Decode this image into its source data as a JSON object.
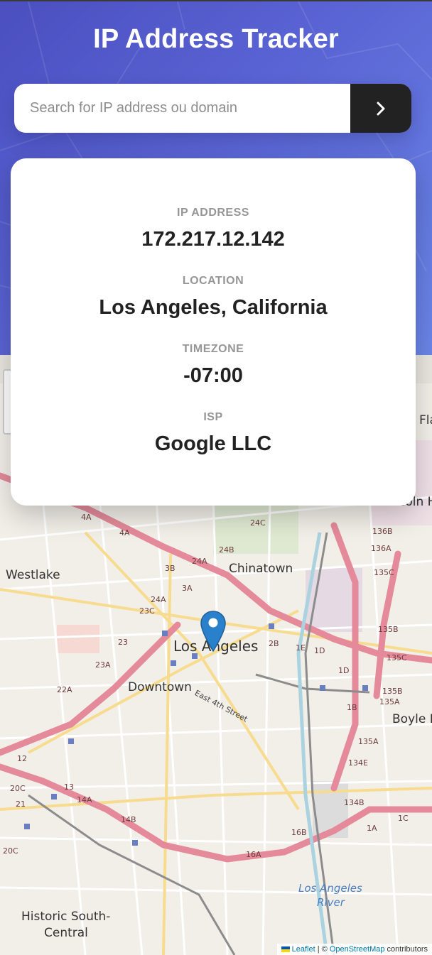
{
  "header": {
    "title": "IP Address Tracker",
    "search_placeholder": "Search for IP address ou domain",
    "search_value": ""
  },
  "info": {
    "ip_label": "IP ADDRESS",
    "ip_value": "172.217.12.142",
    "location_label": "LOCATION",
    "location_value": "Los Angeles, California",
    "timezone_label": "TIMEZONE",
    "timezone_value": "-07:00",
    "isp_label": "ISP",
    "isp_value": "Google LLC"
  },
  "map": {
    "places": {
      "los_angeles": "Los Angeles",
      "downtown": "Downtown",
      "chinatown": "Chinatown",
      "westlake": "Westlake",
      "boyle_heights": "Boyle He",
      "lincoln_heights": "Lincoln He",
      "historic_south_1": "Historic South-",
      "historic_south_2": "Central",
      "la_river_1": "Los Angeles",
      "la_river_2": "River",
      "east_4th": "East 4th Street",
      "fla": "Fla"
    },
    "highway_labels": [
      "4A",
      "4A",
      "24C",
      "24B",
      "24A",
      "3B",
      "3A",
      "23C",
      "24A",
      "23",
      "23A",
      "22A",
      "2B",
      "1E",
      "1D",
      "1D",
      "1B",
      "1A",
      "1C",
      "136B",
      "136A",
      "135C",
      "135B",
      "135C",
      "135B",
      "135A",
      "135A",
      "134E",
      "134B",
      "16B",
      "16A",
      "13",
      "14A",
      "14B",
      "20C",
      "21",
      "12",
      "20C"
    ],
    "attribution_leaflet": "Leaflet",
    "attribution_sep": " | © ",
    "attribution_osm": "OpenStreetMap",
    "attribution_tail": " contributors"
  },
  "colors": {
    "hero_start": "#4b4fc0",
    "hero_end": "#6a86e8",
    "button": "#222222",
    "label": "#969696",
    "value": "#222222",
    "marker": "#2a81cb"
  },
  "icons": {
    "submit": "chevron-right-icon",
    "marker": "map-marker-icon"
  }
}
